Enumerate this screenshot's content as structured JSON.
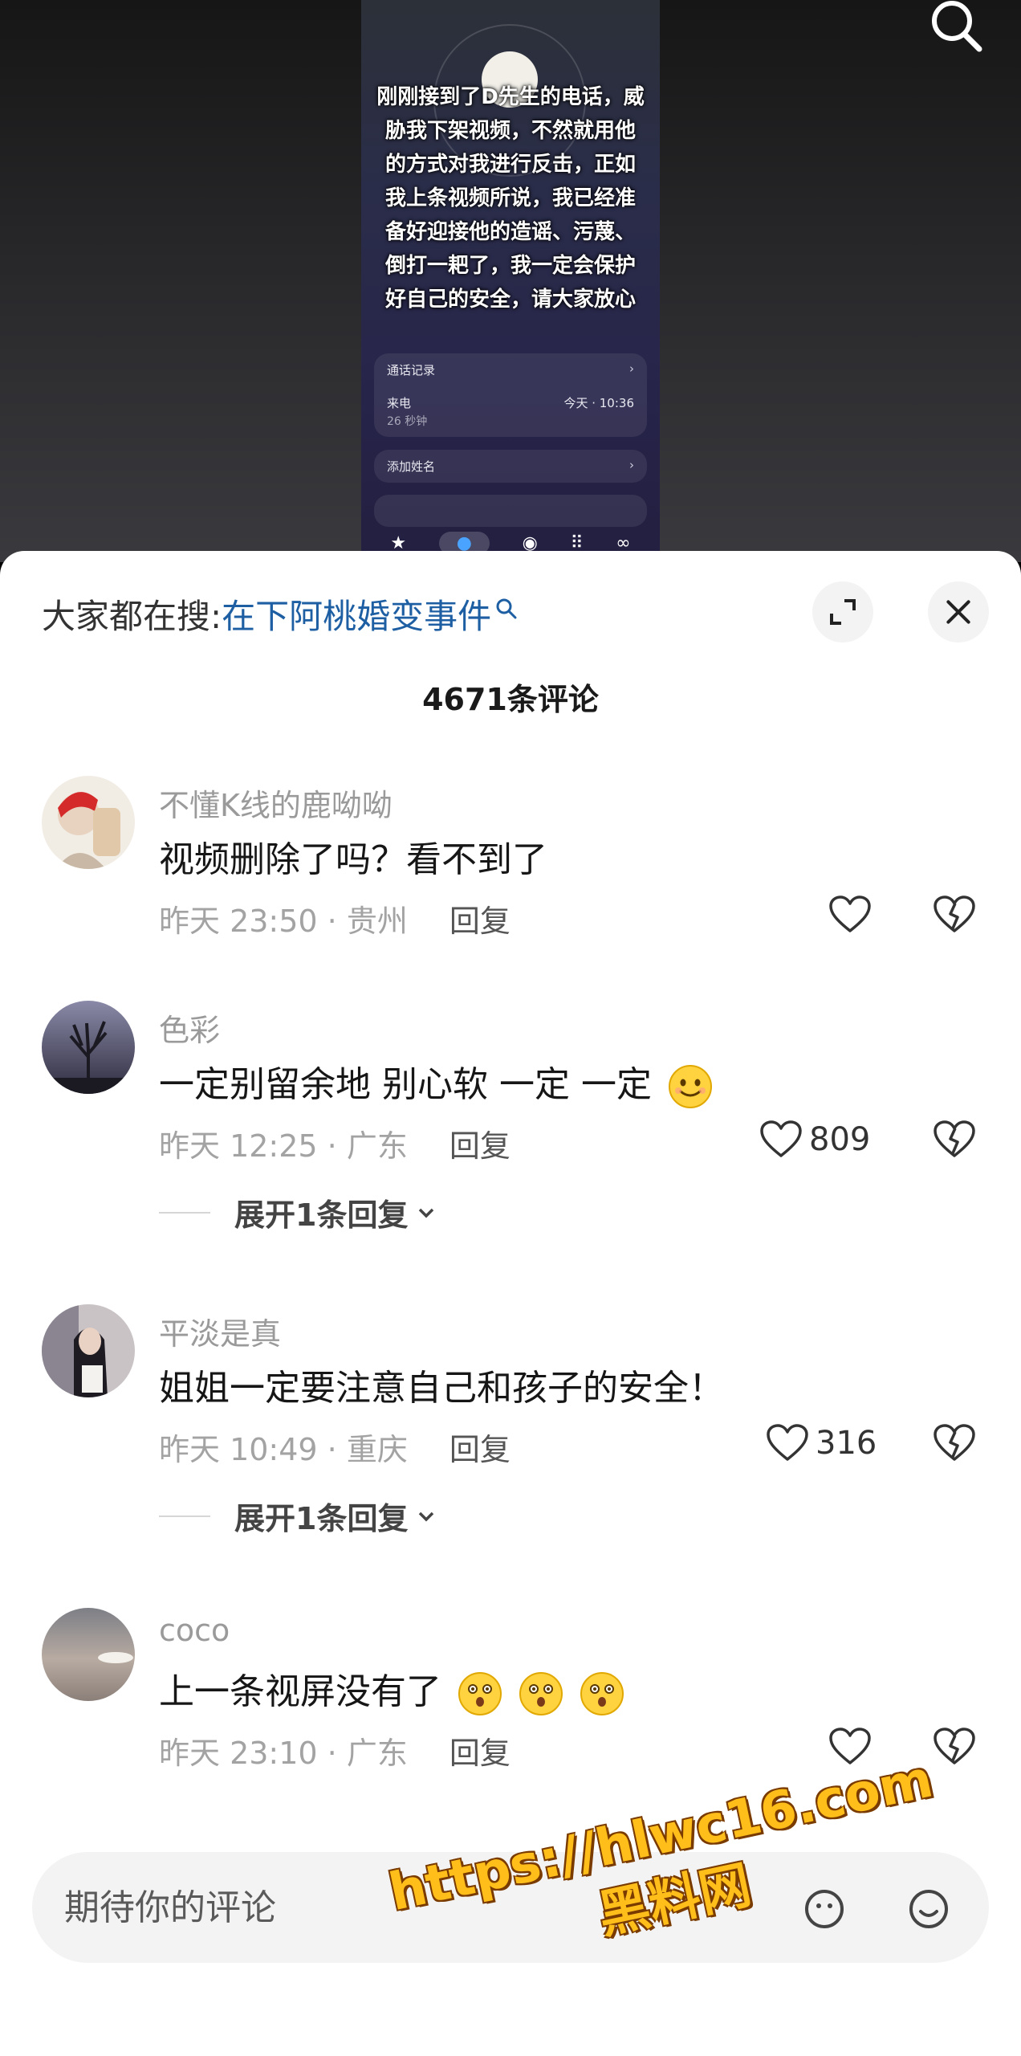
{
  "video": {
    "caption": "刚刚接到了D先生的电话，威胁我下架视频，不然就用他的方式对我进行反击，正如我上条视频所说，我已经准备好迎接他的造谣、污蔑、倒打一耙了，我一定会保护好自己的安全，请大家放心",
    "call_log_label": "通话记录",
    "call_type": "来电",
    "call_time": "今天 · 10:36",
    "call_duration": "26 秒钟",
    "add_name_label": "添加姓名"
  },
  "sheet": {
    "trending_label": "大家都在搜:",
    "trending_link": "在下阿桃婚变事件",
    "comment_count": "4671条评论"
  },
  "comments": [
    {
      "username": "不懂K线的鹿呦呦",
      "text": "视频删除了吗？看不到了",
      "time": "昨天 23:50 · 贵州",
      "reply_label": "回复",
      "likes": ""
    },
    {
      "username": "色彩",
      "text": "一定别留余地 别心软 一定 一定",
      "time": "昨天 12:25 · 广东",
      "reply_label": "回复",
      "likes": "809",
      "expand_label": "展开1条回复"
    },
    {
      "username": "平淡是真",
      "text": "姐姐一定要注意自己和孩子的安全！",
      "time": "昨天 10:49 · 重庆",
      "reply_label": "回复",
      "likes": "316",
      "expand_label": "展开1条回复"
    },
    {
      "username": "coco",
      "text": "上一条视屏没有了",
      "time": "昨天 23:10 · 广东",
      "reply_label": "回复",
      "likes": ""
    }
  ],
  "composer": {
    "placeholder": "期待你的评论"
  },
  "watermark": {
    "url": "https://hlwc16.com",
    "name": "黑料网"
  },
  "colors": {
    "link": "#1e5fa3",
    "watermark": "#ffbe1a"
  }
}
